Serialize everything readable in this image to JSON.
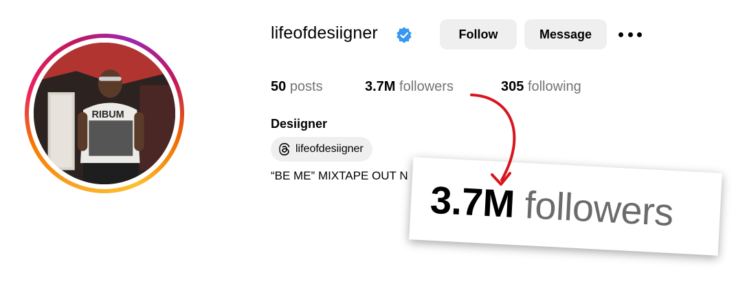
{
  "profile": {
    "username": "lifeofdesiigner",
    "full_name": "Desiigner",
    "bio": "“BE ME” MIXTAPE OUT N",
    "threads_handle": "lifeofdesiigner"
  },
  "actions": {
    "follow_label": "Follow",
    "message_label": "Message"
  },
  "stats": {
    "posts_count": "50",
    "posts_label": "posts",
    "followers_count": "3.7M",
    "followers_label": "followers",
    "following_count": "305",
    "following_label": "following"
  },
  "zoom": {
    "count": "3.7M",
    "label": "followers"
  },
  "colors": {
    "verified_badge": "#3897f0",
    "arrow": "#d9141e",
    "button_bg": "#efefef",
    "muted_text": "#737373"
  },
  "icons": {
    "verified": "verified-badge-icon",
    "more": "more-options-icon",
    "threads": "threads-icon",
    "annotation_arrow": "curved-arrow-icon"
  }
}
